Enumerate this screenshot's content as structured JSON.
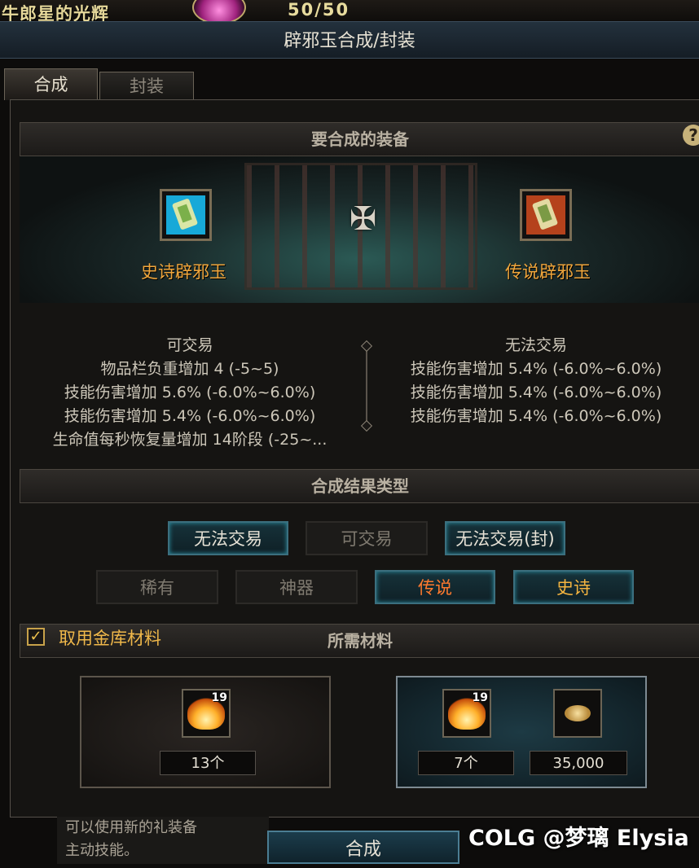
{
  "top": {
    "title": "牛郎星的光辉",
    "count": "50/50"
  },
  "window": {
    "title": "辟邪玉合成/封装"
  },
  "tabs": [
    {
      "label": "合成"
    },
    {
      "label": "封装"
    }
  ],
  "sections": {
    "equipment": "要合成的装备",
    "result_type": "合成结果类型",
    "materials": "所需材料"
  },
  "help_glyph": "?",
  "items": {
    "epic": {
      "name": "史诗辟邪玉"
    },
    "legendary": {
      "name": "传说辟邪玉"
    },
    "plus_glyph": "✠"
  },
  "stats": {
    "left": {
      "trade": "可交易",
      "lines": [
        "物品栏负重增加 4 (-5~5)",
        "技能伤害增加 5.6% (-6.0%~6.0%)",
        "技能伤害增加 5.4% (-6.0%~6.0%)",
        "生命值每秒恢复量增加 14阶段 (-25~..."
      ]
    },
    "right": {
      "trade": "无法交易",
      "lines": [
        "技能伤害增加 5.4% (-6.0%~6.0%)",
        "技能伤害增加 5.4% (-6.0%~6.0%)",
        "技能伤害增加 5.4% (-6.0%~6.0%)"
      ]
    }
  },
  "trade_options": [
    {
      "label": "无法交易",
      "selected": true
    },
    {
      "label": "可交易",
      "selected": false
    },
    {
      "label": "无法交易(封)",
      "selected": true
    }
  ],
  "grade_options": [
    {
      "label": "稀有",
      "selected": false
    },
    {
      "label": "神器",
      "selected": false
    },
    {
      "label": "传说",
      "selected": true
    },
    {
      "label": "史诗",
      "selected": true
    }
  ],
  "checkbox": {
    "label": "取用金库材料",
    "checked": true,
    "glyph": "✓"
  },
  "materials": {
    "owned": {
      "badge": "19",
      "count": "13个"
    },
    "required": {
      "badge": "19",
      "count": "7个",
      "gold": "35,000"
    }
  },
  "bottom": {
    "note_line1": "可以使用新的礼装备",
    "note_line2": "主动技能。",
    "craft_button": "合成"
  },
  "watermark": "COLG @梦璃 Elysia",
  "colors": {
    "legendary": "#ff7a2e",
    "epic": "#f6b540",
    "selected_border": "#3b6f7e"
  }
}
